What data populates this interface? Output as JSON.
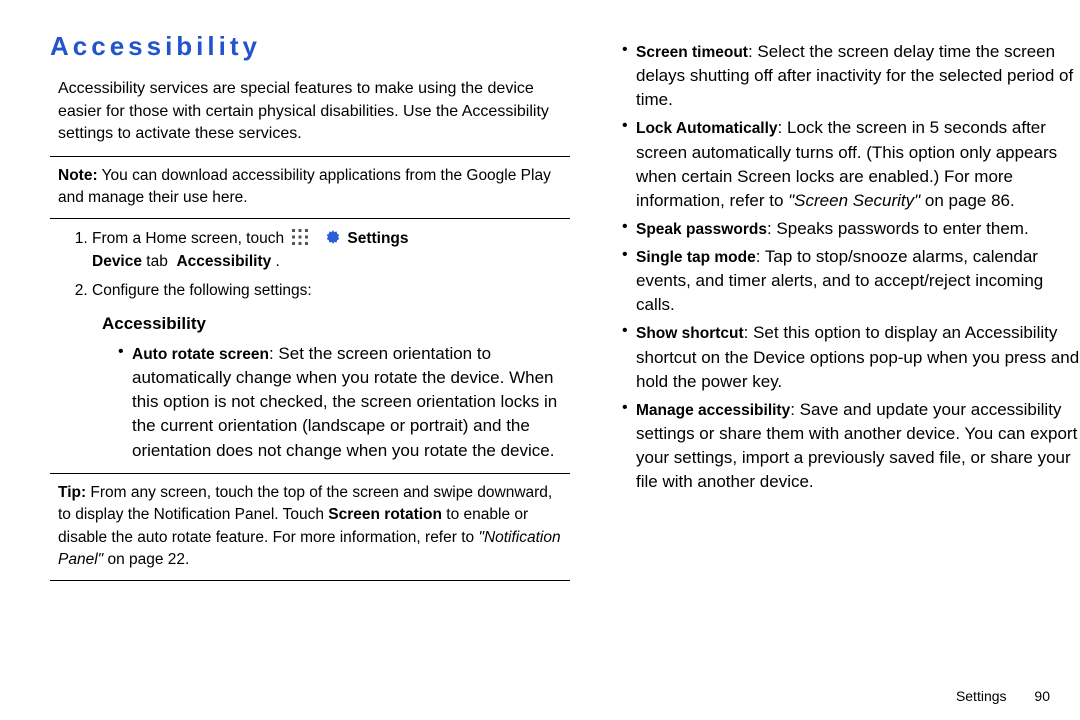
{
  "title": "Accessibility",
  "intro": "Accessibility services are special features to make using the device easier for those with certain physical disabilities. Use the Accessibility settings to activate these services.",
  "note_label": "Note:",
  "note_body": " You can download accessibility applications from the Google Play and manage their use here.",
  "step1_a": "From a Home screen, touch ",
  "step1_settings": " Settings",
  "step1_b_device": "Device",
  "step1_b_tab": " tab ",
  "step1_b_access": " Accessibility",
  "step1_b_end": " .",
  "step2": "Configure the following settings:",
  "subhead_access": "Accessibility",
  "b_left_auto_lead": "Auto rotate screen",
  "b_left_auto_body": ": Set the screen orientation to automatically change when you rotate the device. When this option is not checked, the screen orientation locks in the current orientation (landscape or portrait) and the orientation does not change when you rotate the device.",
  "tip_label": "Tip:",
  "tip_a": " From any screen, touch the top of the screen and swipe downward, to display the Notification Panel. Touch ",
  "tip_screen_rotation": "Screen rotation",
  "tip_b": " to enable or disable the auto rotate feature. For more information, refer to ",
  "tip_ref_title": "\"Notification Panel\"",
  "tip_ref_page": " on page 22.",
  "r_screen_timeout_lead": "Screen timeout",
  "r_screen_timeout_body": ": Select the screen delay time the screen delays shutting off after inactivity for the selected period of time.",
  "r_lock_auto_lead": "Lock Automatically",
  "r_lock_auto_body_a": ": Lock the screen in 5 seconds after screen automatically turns off. (This option only appears when certain Screen locks are enabled.) For more information, refer to ",
  "r_lock_auto_ref": "\"Screen Security\"",
  "r_lock_auto_body_b": " on page 86.",
  "r_speak_lead": "Speak passwords",
  "r_speak_body": ": Speaks passwords to enter them.",
  "r_single_lead": "Single tap mode",
  "r_single_body": ": Tap to stop/snooze alarms, calendar events, and timer alerts, and to accept/reject incoming calls.",
  "r_shortcut_lead": "Show shortcut",
  "r_shortcut_body": ": Set this option to display an Accessibility shortcut on the Device options pop-up when you press and hold the power key.",
  "r_manage_lead": "Manage accessibility",
  "r_manage_body": ": Save and update your accessibility settings or share them with another device. You can export your settings, import a previously saved file, or share your file with another device.",
  "footer_label": "Settings",
  "footer_page": "90"
}
